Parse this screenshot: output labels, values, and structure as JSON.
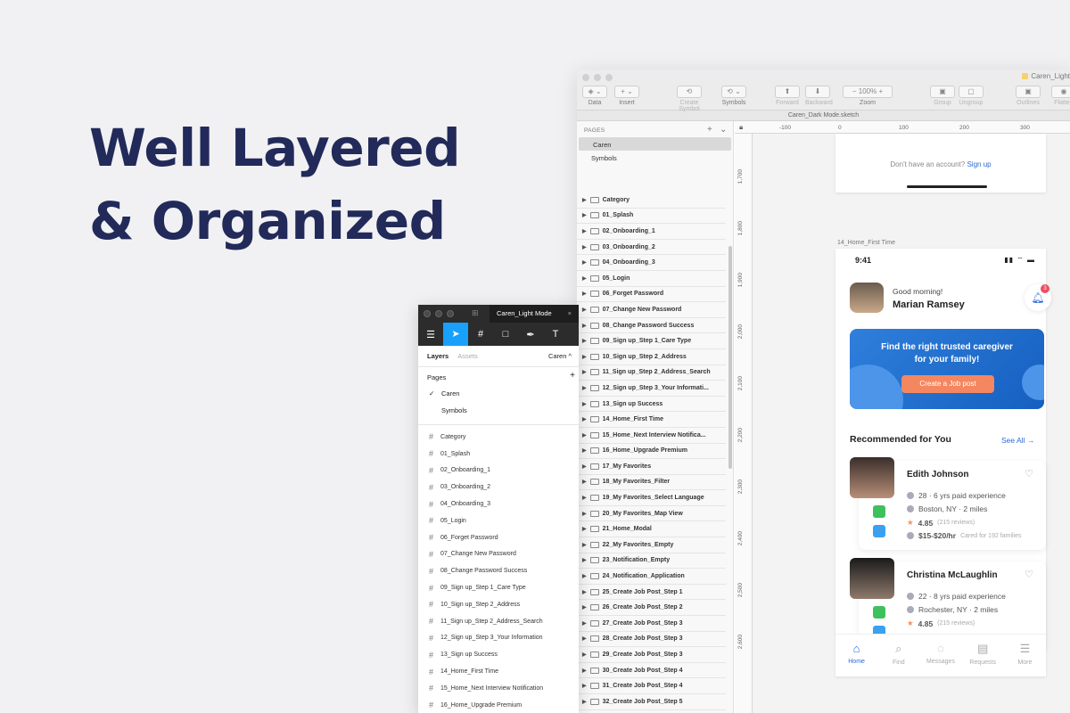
{
  "hero": {
    "line1": "Well Layered",
    "line2": "& Organized"
  },
  "sketch": {
    "file_right": "Caren_Light",
    "doc_title": "Caren_Dark Mode.sketch",
    "toolbar": [
      {
        "label": "Data",
        "box": "◈ ⌄",
        "dim": false
      },
      {
        "label": "Insert",
        "box": "+ ⌄",
        "dim": false
      },
      {
        "label": "Create Symbol",
        "box": "⟲",
        "dim": true
      },
      {
        "label": "Symbols",
        "box": "⟲ ⌄",
        "dim": false
      },
      {
        "label": "Forward",
        "box": "⬆",
        "dim": true
      },
      {
        "label": "Backward",
        "box": "⬇",
        "dim": true
      },
      {
        "label": "Zoom",
        "box": "−  100%  +",
        "dim": false
      },
      {
        "label": "Group",
        "box": "▣",
        "dim": true
      },
      {
        "label": "Ungroup",
        "box": "▢",
        "dim": true
      },
      {
        "label": "Outlines",
        "box": "▣",
        "dim": true
      },
      {
        "label": "Flatten",
        "box": "◉",
        "dim": true
      }
    ],
    "pages_header": "PAGES",
    "pages": [
      "Caren",
      "Symbols"
    ],
    "layers": [
      "Category",
      "01_Splash",
      "02_Onboarding_1",
      "03_Onboarding_2",
      "04_Onboarding_3",
      "05_Login",
      "06_Forget Password",
      "07_Change New Password",
      "08_Change Password Success",
      "09_Sign up_Step 1_Care Type",
      "10_Sign up_Step 2_Address",
      "11_Sign up_Step 2_Address_Search",
      "12_Sign up_Step 3_Your Informati...",
      "13_Sign up Success",
      "14_Home_First Time",
      "15_Home_Next Interview Notifica...",
      "16_Home_Upgrade Premium",
      "17_My Favorites",
      "18_My Favorites_Filter",
      "19_My Favorites_Select Language",
      "20_My Favorites_Map View",
      "21_Home_Modal",
      "22_My Favorites_Empty",
      "23_Notification_Empty",
      "24_Notification_Application",
      "25_Create Job Post_Step 1",
      "26_Create Job Post_Step 2",
      "27_Create Job Post_Step 3",
      "28_Create Job Post_Step 3",
      "29_Create Job Post_Step 3",
      "30_Create Job Post_Step 4",
      "31_Create Job Post_Step 4",
      "32_Create Job Post_Step 5"
    ],
    "ruler_top": [
      "-100",
      "0",
      "100",
      "200",
      "300"
    ],
    "ruler_left": [
      "1,700",
      "1,800",
      "1,900",
      "2,000",
      "2,100",
      "2,200",
      "2,300",
      "2,400",
      "2,500",
      "2,600"
    ],
    "artboard_top_text": "Don't have an account?",
    "artboard_top_link": "Sign up",
    "artboard_label": "14_Home_First Time",
    "phone": {
      "time": "9:41",
      "greeting": "Good morning!",
      "name": "Marian Ramsey",
      "notif_count": "3",
      "banner_text": "Find the right trusted caregiver for your family!",
      "banner_button": "Create a Job post",
      "section_title": "Recommended for You",
      "see_all": "See All →",
      "cards": [
        {
          "name": "Edith Johnson",
          "line1": "28  ·  6 yrs paid experience",
          "line2": "Boston, NY  ·  2 miles",
          "rating": "4.85",
          "reviews": "(215 reviews)",
          "rate": "$15-$20/hr",
          "rate_note": "Cared for 192 families"
        },
        {
          "name": "Christina McLaughlin",
          "line1": "22  ·  8 yrs paid experience",
          "line2": "Rochester, NY  ·  2 miles",
          "rating": "4.85",
          "reviews": "(215 reviews)"
        }
      ],
      "tabs": [
        "Home",
        "Find",
        "Messages",
        "Requests",
        "More"
      ]
    }
  },
  "figma": {
    "tab": "Caren_Light Mode",
    "sub_layers": "Layers",
    "sub_assets": "Assets",
    "sub_page": "Caren ^",
    "pages_label": "Pages",
    "pages": [
      "Caren",
      "Symbols"
    ],
    "layers": [
      "Category",
      "01_Splash",
      "02_Onboarding_1",
      "03_Onboarding_2",
      "04_Onboarding_3",
      "05_Login",
      "06_Forget Password",
      "07_Change New Password",
      "08_Change Password Success",
      "09_Sign up_Step 1_Care Type",
      "10_Sign up_Step 2_Address",
      "11_Sign up_Step 2_Address_Search",
      "12_Sign up_Step 3_Your Information",
      "13_Sign up Success",
      "14_Home_First Time",
      "15_Home_Next Interview Notification",
      "16_Home_Upgrade Premium"
    ]
  }
}
